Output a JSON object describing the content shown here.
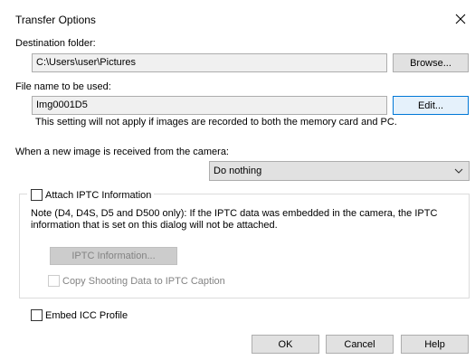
{
  "window": {
    "title": "Transfer Options",
    "close_icon": "close-icon"
  },
  "destination": {
    "label": "Destination folder:",
    "value": "C:\\Users\\user\\Pictures",
    "browse_label": "Browse..."
  },
  "filename": {
    "label": "File name to be used:",
    "value": "Img0001D5",
    "edit_label": "Edit...",
    "note": "This setting will not apply if images are recorded to both the memory card and PC."
  },
  "new_image": {
    "label": "When a new image is received from the camera:",
    "selected": "Do nothing"
  },
  "iptc": {
    "attach_label": "Attach IPTC Information",
    "attach_checked": false,
    "note_line1": "Note (D4, D4S, D5 and D500 only): If the IPTC data was embedded in the camera, the IPTC",
    "note_line2": "information that is set on this dialog will not be attached.",
    "info_button": "IPTC Information...",
    "copy_label": "Copy Shooting Data to IPTC Caption",
    "copy_checked": false
  },
  "icc": {
    "label": "Embed ICC Profile",
    "checked": false
  },
  "footer": {
    "ok": "OK",
    "cancel": "Cancel",
    "help": "Help"
  }
}
